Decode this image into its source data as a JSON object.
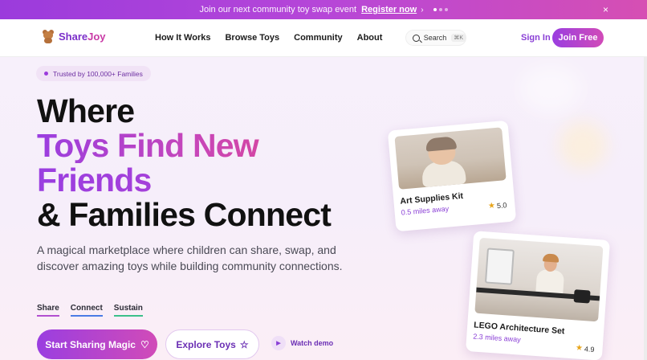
{
  "announcement": {
    "message": "Join our next community toy swap event",
    "link_label": "Register now",
    "chevron": "›",
    "close_icon": "×"
  },
  "brand": {
    "name_part1": "Share",
    "name_part2": "Joy",
    "icon": "teddy-bear-icon"
  },
  "nav": {
    "links": [
      "How It Works",
      "Browse Toys",
      "Community",
      "About"
    ],
    "search_label": "Search",
    "search_shortcut": "⌘K",
    "signin_label": "Sign In",
    "join_label": "Join Free"
  },
  "hero": {
    "badge": "Trusted by 100,000+ Families",
    "headline": {
      "line1": "Where",
      "line2": "Toys Find New",
      "line3": "Friends",
      "line4": "& Families Connect"
    },
    "subtitle": "A magical marketplace where children can share, swap, and discover amazing toys while building community connections.",
    "pillars": [
      "Share",
      "Connect",
      "Sustain"
    ],
    "primary_cta": "Start Sharing Magic",
    "primary_cta_icon": "♡",
    "secondary_cta": "Explore Toys",
    "secondary_cta_icon": "☆",
    "watch_label": "Watch demo",
    "watch_icon": "▶"
  },
  "cards": [
    {
      "title": "Art Supplies Kit",
      "distance": "0.5 miles away",
      "rating": "5.0",
      "star": "★"
    },
    {
      "title": "LEGO Architecture Set",
      "distance": "2.3 miles away",
      "rating": "4.9",
      "star": "★"
    }
  ],
  "colors": {
    "accent_purple": "#9a3ee0",
    "accent_pink": "#d14bb8",
    "text_dark": "#111111"
  }
}
